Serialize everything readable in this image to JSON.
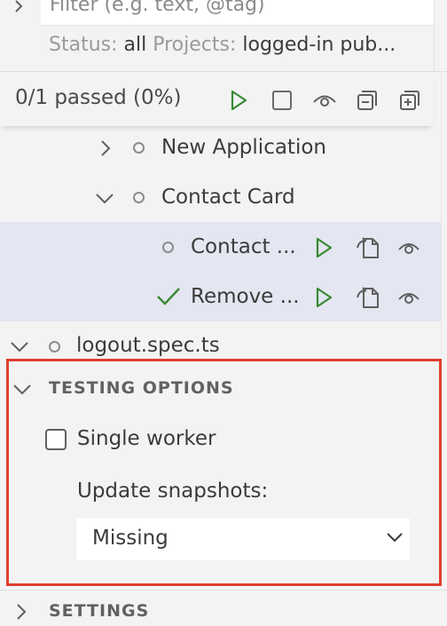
{
  "filter": {
    "placeholder": "Filter (e.g. text, @tag)"
  },
  "status_line": {
    "status_label": "Status:",
    "status_value": "all",
    "projects_label": "Projects:",
    "projects_value": "logged-in pub..."
  },
  "toolbar": {
    "passed_text": "0/1 passed (0%)",
    "buttons": [
      "run-all",
      "stop",
      "watch",
      "collapse-all",
      "expand-all"
    ]
  },
  "tree": {
    "items": [
      {
        "label": "New Application",
        "expanded": false,
        "status": "not-run"
      },
      {
        "label": "Contact Card",
        "expanded": true,
        "status": "not-run"
      },
      {
        "label": "Contact ...",
        "status": "not-run"
      },
      {
        "label": "Remove ...",
        "status": "passed"
      },
      {
        "label": "logout.spec.ts",
        "expanded": true,
        "status": "not-run"
      }
    ]
  },
  "testing_options": {
    "title": "TESTING OPTIONS",
    "single_worker_label": "Single worker",
    "single_worker_checked": false,
    "update_snapshots_label": "Update snapshots:",
    "update_snapshots_value": "Missing"
  },
  "settings": {
    "title": "SETTINGS"
  },
  "colors": {
    "accent_green": "#388a34",
    "highlight_row": "#e4e6f1",
    "annotation_red": "#e03e2d"
  }
}
